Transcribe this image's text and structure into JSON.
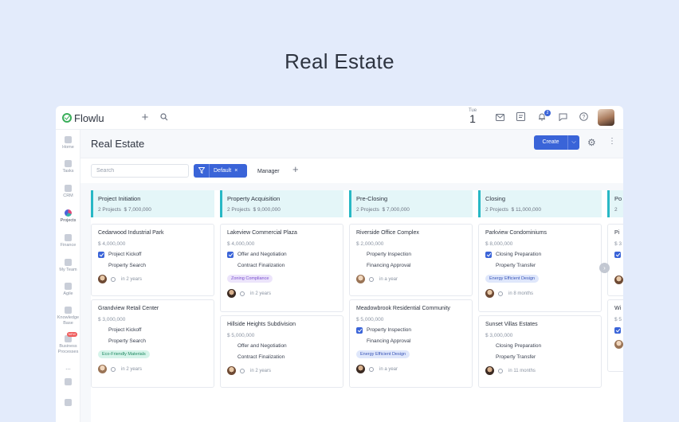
{
  "hero_title": "Real Estate",
  "app": {
    "logo_text": "Flowlu",
    "date_day": "Tue",
    "date_num": "1",
    "notification_count": "2"
  },
  "sidebar": {
    "items": [
      {
        "label": "Home",
        "icon": "home-icon"
      },
      {
        "label": "Tasks",
        "icon": "tasks-icon"
      },
      {
        "label": "CRM",
        "icon": "crm-icon"
      },
      {
        "label": "Projects",
        "icon": "projects-icon"
      },
      {
        "label": "Finance",
        "icon": "finance-icon"
      },
      {
        "label": "My Team",
        "icon": "team-icon"
      },
      {
        "label": "Agile",
        "icon": "agile-icon"
      },
      {
        "label": "Knowledge Base",
        "icon": "knowledge-icon"
      },
      {
        "label": "Business Processes",
        "icon": "process-icon"
      }
    ],
    "new_badge": "NEW",
    "more": "..."
  },
  "header": {
    "title": "Real Estate",
    "create_label": "Create"
  },
  "filters": {
    "search_placeholder": "Search",
    "default_label": "Default",
    "manager_label": "Manager"
  },
  "columns": [
    {
      "name": "Project Initiation",
      "count": "2 Projects",
      "total": "$ 7,000,000",
      "cards": [
        {
          "title": "Cedarwood Industrial Park",
          "amount": "$ 4,000,000",
          "tasks": [
            {
              "label": "Project Kickoff",
              "done": true
            },
            {
              "label": "Property Search",
              "done": false
            }
          ],
          "tag": "",
          "due": "in 2 years"
        },
        {
          "title": "Grandview Retail Center",
          "amount": "$ 3,000,000",
          "tasks": [
            {
              "label": "Project Kickoff",
              "done": false
            },
            {
              "label": "Property Search",
              "done": false
            }
          ],
          "tag": "Eco-Friendly Materials",
          "due": "in 2 years"
        }
      ]
    },
    {
      "name": "Property Acquisition",
      "count": "2 Projects",
      "total": "$ 9,000,000",
      "cards": [
        {
          "title": "Lakeview Commercial Plaza",
          "amount": "$ 4,000,000",
          "tasks": [
            {
              "label": "Offer and Negotiation",
              "done": true
            },
            {
              "label": "Contract Finalization",
              "done": false
            }
          ],
          "tag": "Zoning Compliance",
          "due": "in 2 years"
        },
        {
          "title": "Hillside Heights Subdivision",
          "amount": "$ 5,000,000",
          "tasks": [
            {
              "label": "Offer and Negotiation",
              "done": false
            },
            {
              "label": "Contract Finalization",
              "done": false
            }
          ],
          "tag": "",
          "due": "in 2 years"
        }
      ]
    },
    {
      "name": "Pre-Closing",
      "count": "2 Projects",
      "total": "$ 7,000,000",
      "cards": [
        {
          "title": "Riverside Office Complex",
          "amount": "$ 2,000,000",
          "tasks": [
            {
              "label": "Property Inspection",
              "done": false
            },
            {
              "label": "Financing Approval",
              "done": false
            }
          ],
          "tag": "",
          "due": "in a year"
        },
        {
          "title": "Meadowbrook Residential Community",
          "amount": "$ 5,000,000",
          "tasks": [
            {
              "label": "Property Inspection",
              "done": true
            },
            {
              "label": "Financing Approval",
              "done": false
            }
          ],
          "tag": "Energy Efficient Design",
          "due": "in a year"
        }
      ]
    },
    {
      "name": "Closing",
      "count": "2 Projects",
      "total": "$ 11,000,000",
      "cards": [
        {
          "title": "Parkview Condominiums",
          "amount": "$ 8,000,000",
          "tasks": [
            {
              "label": "Closing Preparation",
              "done": true
            },
            {
              "label": "Property Transfer",
              "done": false
            }
          ],
          "tag": "Energy Efficient Design",
          "due": "in 8 months"
        },
        {
          "title": "Sunset Villas Estates",
          "amount": "$ 3,000,000",
          "tasks": [
            {
              "label": "Closing Preparation",
              "done": false
            },
            {
              "label": "Property Transfer",
              "done": false
            }
          ],
          "tag": "",
          "due": "in 11 months"
        }
      ]
    },
    {
      "name": "Po",
      "count": "2",
      "total": "",
      "cards": [
        {
          "title": "Pi",
          "amount": "$ 3",
          "tasks": [
            {
              "label": "",
              "done": true
            }
          ],
          "tag": "",
          "due": ""
        },
        {
          "title": "Wi",
          "amount": "$ 5",
          "tasks": [
            {
              "label": "",
              "done": true
            }
          ],
          "tag": "",
          "due": ""
        }
      ]
    }
  ],
  "colors": {
    "accent": "#3a64d8",
    "column_header_bg": "#e4f6f8",
    "column_header_border": "#28b8c5",
    "page_bg": "#e3ebfb"
  }
}
